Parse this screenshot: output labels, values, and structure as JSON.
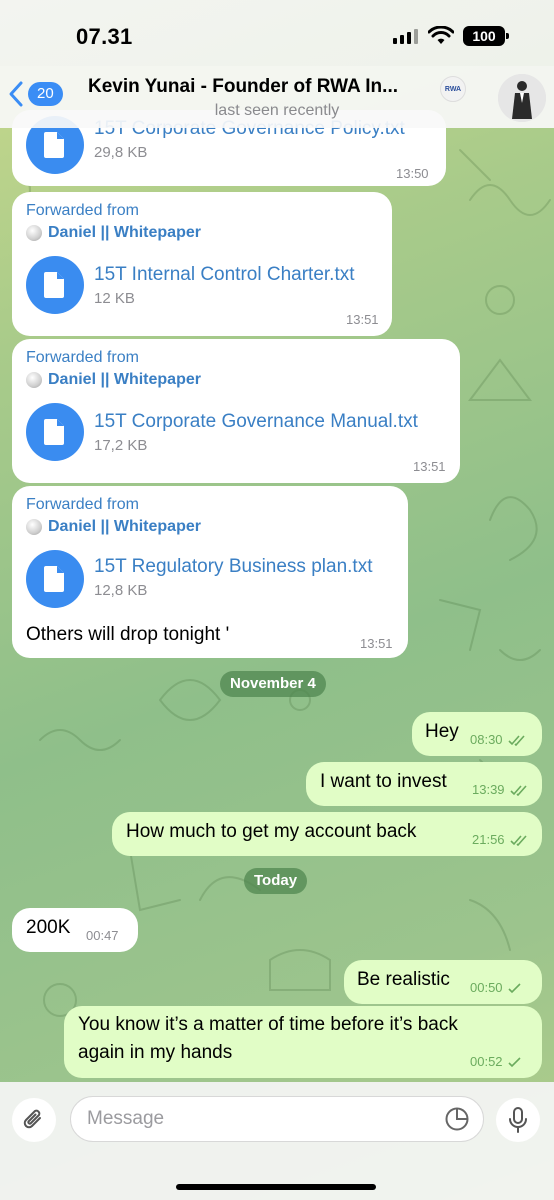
{
  "status_bar": {
    "time": "07.31",
    "battery": "100"
  },
  "header": {
    "back_count": "20",
    "title": "Kevin Yunai - Founder of RWA In...",
    "logo_text": "RWA",
    "subtitle": "last seen recently"
  },
  "messages": [
    {
      "type": "file",
      "file_name": "15T Corporate Governance Policy.txt",
      "file_size": "29,8 KB",
      "time": "13:50"
    },
    {
      "type": "file",
      "forwarded_label": "Forwarded from",
      "forwarded_from": "Daniel || Whitepaper",
      "file_name": "15T Internal Control Charter.txt",
      "file_size": "12 KB",
      "time": "13:51"
    },
    {
      "type": "file",
      "forwarded_label": "Forwarded from",
      "forwarded_from": "Daniel || Whitepaper",
      "file_name": "15T Corporate Governance Manual.txt",
      "file_size": "17,2 KB",
      "time": "13:51"
    },
    {
      "type": "file",
      "forwarded_label": "Forwarded from",
      "forwarded_from": "Daniel || Whitepaper",
      "file_name": "15T Regulatory Business plan.txt",
      "file_size": "12,8 KB",
      "caption": "Others will drop tonight '",
      "time": "13:51"
    },
    {
      "type": "date",
      "text": "November 4"
    },
    {
      "type": "out",
      "text": "Hey",
      "time": "08:30"
    },
    {
      "type": "out",
      "text": "I want to invest",
      "time": "13:39"
    },
    {
      "type": "out",
      "text": "How much to get my account back",
      "time": "21:56"
    },
    {
      "type": "date",
      "text": "Today"
    },
    {
      "type": "in",
      "text": "200K",
      "time": "00:47"
    },
    {
      "type": "out",
      "text": "Be realistic",
      "time": "00:50"
    },
    {
      "type": "out",
      "text_line1": "You know it’s a matter of time before it’s back",
      "text_line2": "again in my hands",
      "time": "00:52"
    }
  ],
  "input": {
    "placeholder": "Message"
  },
  "colors": {
    "accent": "#3a8df5",
    "outgoing_bubble": "#e1fdc6",
    "incoming_bubble": "#ffffff",
    "read_ticks": "#6bab5e"
  }
}
